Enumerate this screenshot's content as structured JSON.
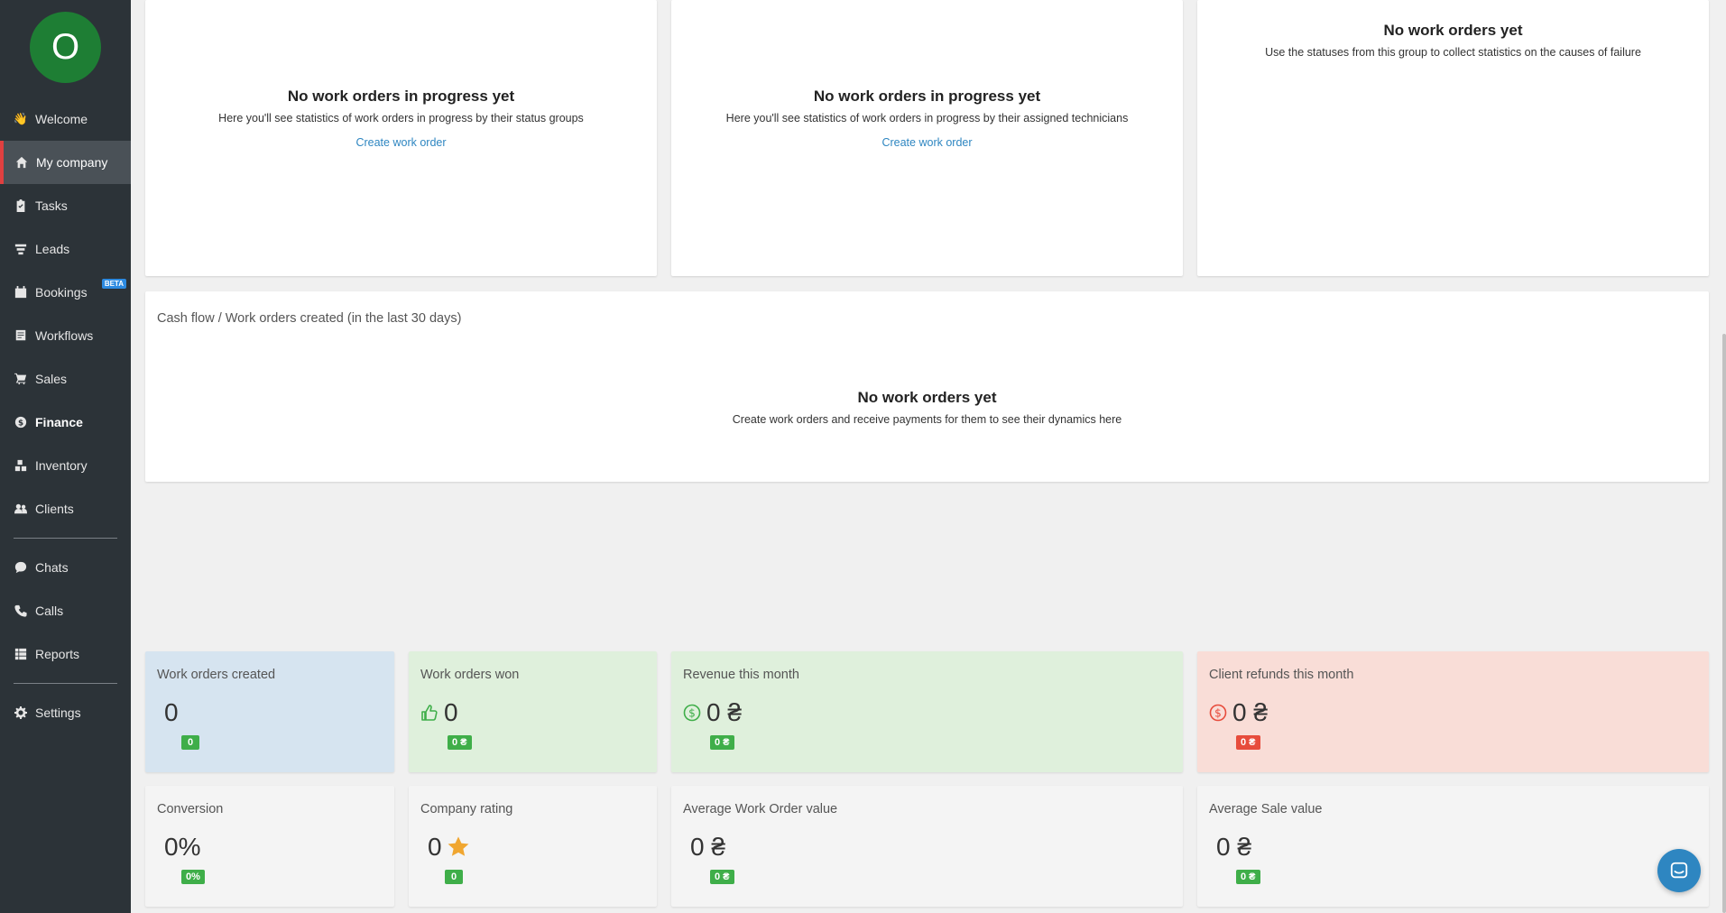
{
  "sidebar": {
    "avatar_letter": "O",
    "items": [
      {
        "label": "Welcome",
        "icon": "waving-hand-icon"
      },
      {
        "label": "My company",
        "icon": "home-icon"
      },
      {
        "label": "Tasks",
        "icon": "clipboard-check-icon"
      },
      {
        "label": "Leads",
        "icon": "funnel-icon"
      },
      {
        "label": "Bookings",
        "icon": "calendar-icon",
        "badge": "BETA"
      },
      {
        "label": "Workflows",
        "icon": "workflow-icon"
      },
      {
        "label": "Sales",
        "icon": "cart-icon"
      },
      {
        "label": "Finance",
        "icon": "dollar-circle-icon"
      },
      {
        "label": "Inventory",
        "icon": "boxes-icon"
      },
      {
        "label": "Clients",
        "icon": "users-icon"
      },
      {
        "label": "Chats",
        "icon": "chat-icon"
      },
      {
        "label": "Calls",
        "icon": "phone-icon"
      },
      {
        "label": "Reports",
        "icon": "table-icon"
      },
      {
        "label": "Settings",
        "icon": "gear-icon"
      }
    ],
    "active_label": "My company"
  },
  "status_cards": [
    {
      "title": "No work orders in progress yet",
      "subtitle": "Here you'll see statistics of work orders in progress by their status groups",
      "link": "Create work order"
    },
    {
      "title": "No work orders in progress yet",
      "subtitle": "Here you'll see statistics of work orders in progress by their assigned technicians",
      "link": "Create work order"
    },
    {
      "title": "No work orders yet",
      "subtitle": "Use the statuses from this group to collect statistics on the causes of failure"
    }
  ],
  "cash_flow": {
    "title": "Cash flow / Work orders created (in the last 30 days)",
    "empty_title": "No work orders yet",
    "empty_subtitle": "Create work orders and receive payments for them to see their dynamics here"
  },
  "tiles_row1": [
    {
      "label": "Work orders created",
      "value": "0",
      "badge": "0",
      "bg": "#d6e4f0"
    },
    {
      "label": "Work orders won",
      "value": "0",
      "badge": "0 ₴",
      "bg": "#dff0dc",
      "icon": "thumbs-up-icon"
    },
    {
      "label": "Revenue this month",
      "value": "0 ₴",
      "badge": "0 ₴",
      "bg": "#dff0dc",
      "icon": "dollar-circle-icon"
    },
    {
      "label": "Client refunds this month",
      "value": "0 ₴",
      "badge": "0 ₴",
      "bg": "#f9ddd7",
      "icon": "dollar-circle-icon",
      "badge_color": "red"
    }
  ],
  "tiles_row2": [
    {
      "label": "Conversion",
      "value": "0%",
      "badge": "0%"
    },
    {
      "label": "Company rating",
      "value": "0",
      "badge": "0",
      "icon": "star-icon"
    },
    {
      "label": "Average Work Order value",
      "value": "0 ₴",
      "badge": "0 ₴"
    },
    {
      "label": "Average Sale value",
      "value": "0 ₴",
      "badge": "0 ₴"
    }
  ],
  "colors": {
    "sidebar_bg": "#2c3338",
    "active_accent": "#e04040",
    "link": "#2e86c1",
    "badge_green": "#3fae49",
    "badge_red": "#e74c3c"
  }
}
